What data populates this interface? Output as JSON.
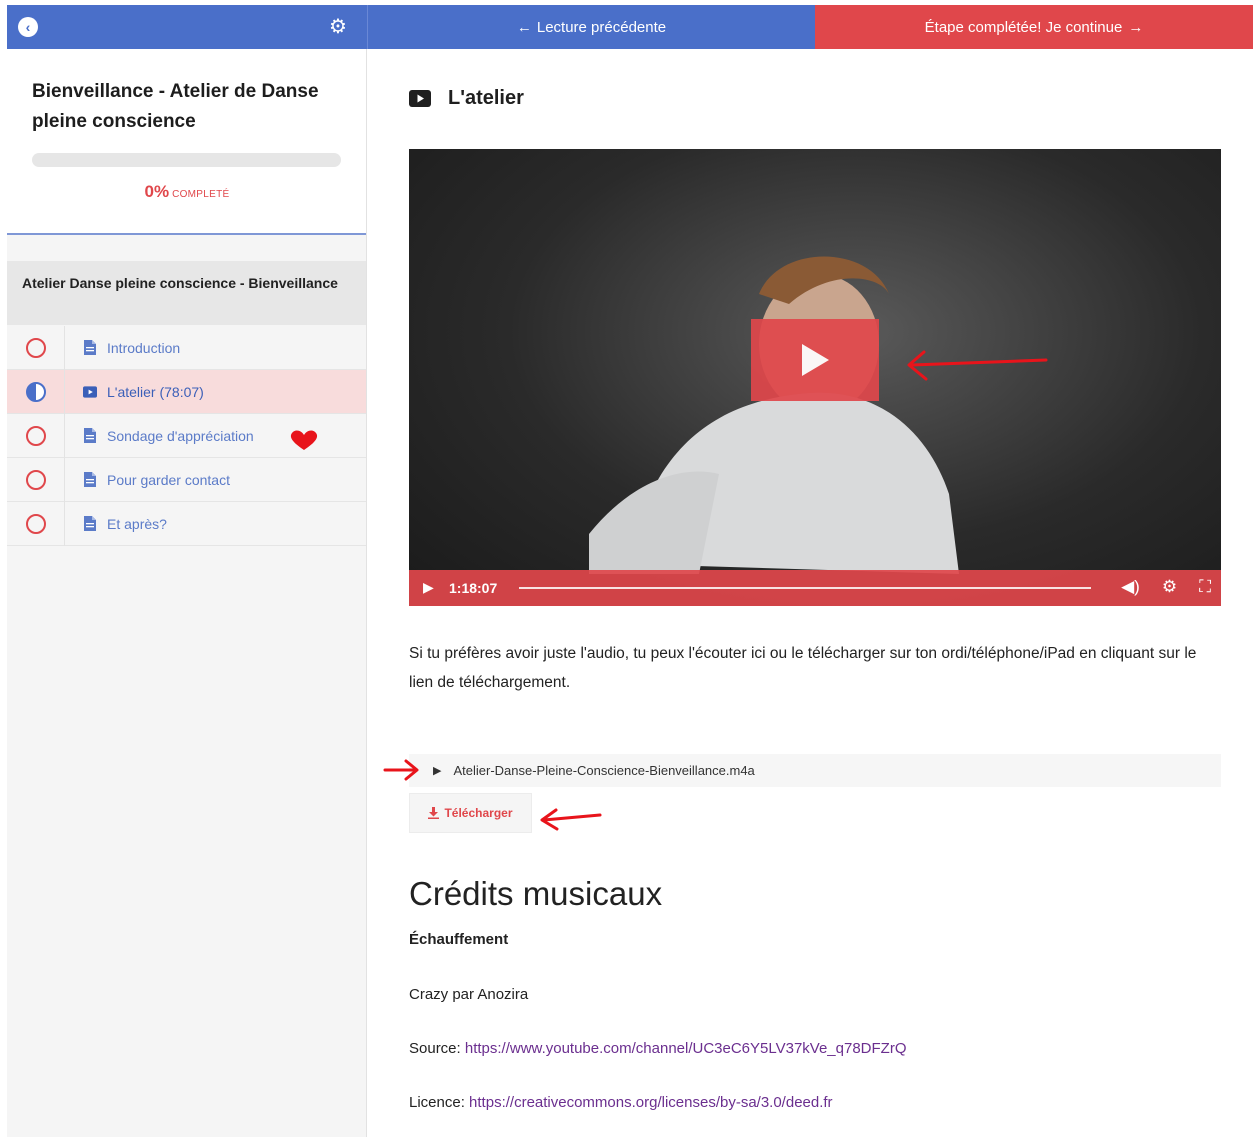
{
  "topbar": {
    "prev_label": "Lecture précédente",
    "next_label": "Étape complétée! Je continue",
    "brand_color": "#4a6fc9",
    "accent_color": "#e0474b"
  },
  "sidebar": {
    "course_title": "Bienveillance - Atelier de Danse pleine conscience",
    "progress": {
      "value": 0,
      "percent_label": "0%",
      "label": "COMPLETÉ"
    },
    "section_title": "Atelier Danse pleine conscience - Bienveillance",
    "lessons": [
      {
        "label": "Introduction",
        "icon": "document-icon",
        "status": "not-started"
      },
      {
        "label": "L'atelier (78:07)",
        "icon": "video-icon",
        "status": "in-progress"
      },
      {
        "label": "Sondage d'appréciation",
        "icon": "document-icon",
        "status": "not-started"
      },
      {
        "label": "Pour garder contact",
        "icon": "document-icon",
        "status": "not-started"
      },
      {
        "label": "Et après?",
        "icon": "document-icon",
        "status": "not-started"
      }
    ]
  },
  "main": {
    "heading": "L'atelier",
    "video": {
      "timecode": "1:18:07"
    },
    "paragraph": "Si tu préfères avoir juste l'audio, tu peux l'écouter ici ou le télécharger sur ton ordi/téléphone/iPad en cliquant sur le lien de téléchargement.",
    "audio_file": "Atelier-Danse-Pleine-Conscience-Bienveillance.m4a",
    "download_label": "Télécharger",
    "credits": {
      "title": "Crédits musicaux",
      "subtitle": "Échauffement",
      "track": "Crazy par Anozira",
      "source_label": "Source:",
      "source_url": "https://www.youtube.com/channel/UC3eC6Y5LV37kVe_q78DFZrQ",
      "licence_label": "Licence:",
      "licence_url": "https://creativecommons.org/licenses/by-sa/3.0/deed.fr"
    }
  }
}
